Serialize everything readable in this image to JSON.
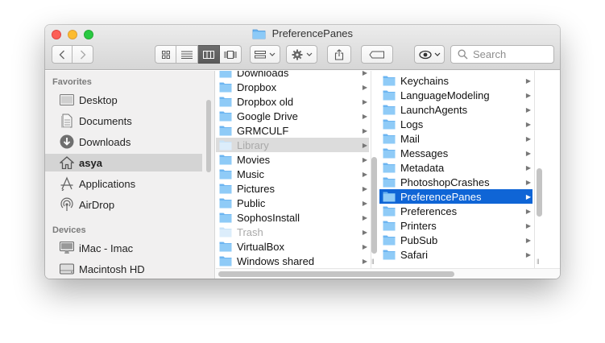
{
  "window": {
    "title": "PreferencePanes"
  },
  "toolbar": {
    "search_placeholder": "Search",
    "accent_color": "#0f65d6"
  },
  "sidebar": {
    "favorites_heading": "Favorites",
    "favorites": [
      {
        "label": "Desktop",
        "icon": "desktop-icon"
      },
      {
        "label": "Documents",
        "icon": "documents-icon"
      },
      {
        "label": "Downloads",
        "icon": "downloads-icon"
      },
      {
        "label": "asya",
        "icon": "home-icon"
      },
      {
        "label": "Applications",
        "icon": "applications-icon"
      },
      {
        "label": "AirDrop",
        "icon": "airdrop-icon"
      }
    ],
    "devices_heading": "Devices",
    "devices": [
      {
        "label": "iMac - Imac",
        "icon": "imac-icon"
      },
      {
        "label": "Macintosh HD",
        "icon": "harddisk-icon"
      }
    ]
  },
  "column1": {
    "items": [
      {
        "label": "Downloads"
      },
      {
        "label": "Dropbox"
      },
      {
        "label": "Dropbox old"
      },
      {
        "label": "Google Drive"
      },
      {
        "label": "GRMCULF"
      },
      {
        "label": "Library"
      },
      {
        "label": "Movies"
      },
      {
        "label": "Music"
      },
      {
        "label": "Pictures"
      },
      {
        "label": "Public"
      },
      {
        "label": "SophosInstall"
      },
      {
        "label": "Trash"
      },
      {
        "label": "VirtualBox"
      },
      {
        "label": "Windows shared"
      }
    ]
  },
  "column2": {
    "items": [
      {
        "label": "Keychains"
      },
      {
        "label": "LanguageModeling"
      },
      {
        "label": "LaunchAgents"
      },
      {
        "label": "Logs"
      },
      {
        "label": "Mail"
      },
      {
        "label": "Messages"
      },
      {
        "label": "Metadata"
      },
      {
        "label": "PhotoshopCrashes"
      },
      {
        "label": "PreferencePanes"
      },
      {
        "label": "Preferences"
      },
      {
        "label": "Printers"
      },
      {
        "label": "PubSub"
      },
      {
        "label": "Safari"
      }
    ]
  }
}
